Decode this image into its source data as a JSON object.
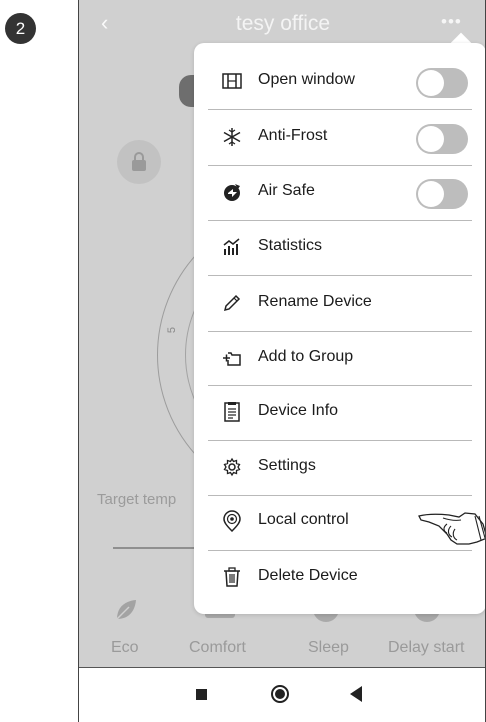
{
  "step_badge": "2",
  "header": {
    "back_icon": "chevron-left-icon",
    "title": "tesy office",
    "more_icon": "more-horizontal-icon"
  },
  "background": {
    "dial_number": "5",
    "target_label": "Target temp",
    "modes": [
      {
        "label": "Eco",
        "icon": "leaf-icon"
      },
      {
        "label": "Comfort",
        "icon": "sofa-icon"
      },
      {
        "label": "Sleep",
        "icon": "moon-icon"
      },
      {
        "label": "Delay start",
        "icon": "clock-icon"
      }
    ]
  },
  "menu": {
    "items": [
      {
        "label": "Open window",
        "icon": "window-icon",
        "toggle": true,
        "on": false
      },
      {
        "label": "Anti-Frost",
        "icon": "snowflake-icon",
        "toggle": true,
        "on": false
      },
      {
        "label": "Air Safe",
        "icon": "air-safe-icon",
        "toggle": true,
        "on": false
      },
      {
        "label": "Statistics",
        "icon": "statistics-icon"
      },
      {
        "label": "Rename Device",
        "icon": "pencil-icon"
      },
      {
        "label": "Add to Group",
        "icon": "add-folder-icon"
      },
      {
        "label": "Device Info",
        "icon": "document-icon"
      },
      {
        "label": "Settings",
        "icon": "gear-icon"
      },
      {
        "label": "Local control",
        "icon": "wifi-pin-icon"
      },
      {
        "label": "Delete Device",
        "icon": "trash-icon"
      }
    ]
  },
  "navbar": {
    "recents": "square-icon",
    "home": "circle-icon",
    "back": "triangle-back-icon"
  },
  "colors": {
    "overlay": "#d0d0d0",
    "menu_bg": "#ffffff",
    "toggle_off": "#bdbdbd",
    "text": "#1b1b1b"
  }
}
